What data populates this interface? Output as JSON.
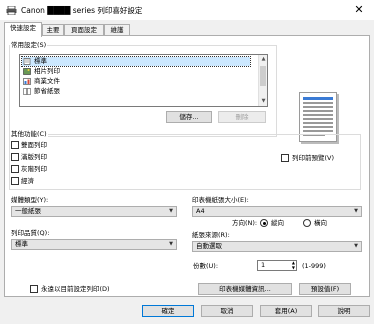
{
  "window": {
    "title": "Canon ████ series 列印喜好設定",
    "close_glyph": "✕"
  },
  "tabs": [
    "快速設定",
    "主要",
    "頁面設定",
    "維護"
  ],
  "common_settings": {
    "label": "常用設定(S)",
    "items": [
      "標準",
      "相片列印",
      "商業文件",
      "節省紙張"
    ],
    "save_button": "儲存...",
    "delete_button": "刪除"
  },
  "preview_check": "列印前預覽(V)",
  "additional": {
    "label": "其他功能(C)",
    "options": [
      "雙面列印",
      "滿版列印",
      "灰階列印",
      "經濟"
    ]
  },
  "media_type": {
    "label": "媒體類型(Y):",
    "value": "一般紙張"
  },
  "print_quality": {
    "label": "列印品質(Q):",
    "value": "標準"
  },
  "paper_size": {
    "label": "印表機紙張大小(E):",
    "value": "A4"
  },
  "orientation": {
    "label": "方向(N):",
    "portrait": "縱向",
    "landscape": "橫向"
  },
  "paper_source": {
    "label": "紙張來源(R):",
    "value": "自動選取"
  },
  "copies": {
    "label": "份數(U):",
    "value": "1",
    "range": "(1-999)"
  },
  "always_print_check": "永遠以目前設定列印(D)",
  "printer_info_button": "印表機媒體資訊...",
  "defaults_button": "預設值(F)",
  "footer": {
    "ok": "確定",
    "cancel": "取消",
    "apply": "套用(A)",
    "help": "說明"
  },
  "colors": {
    "accent": "#0078d7",
    "selection": "#cce8ff"
  }
}
